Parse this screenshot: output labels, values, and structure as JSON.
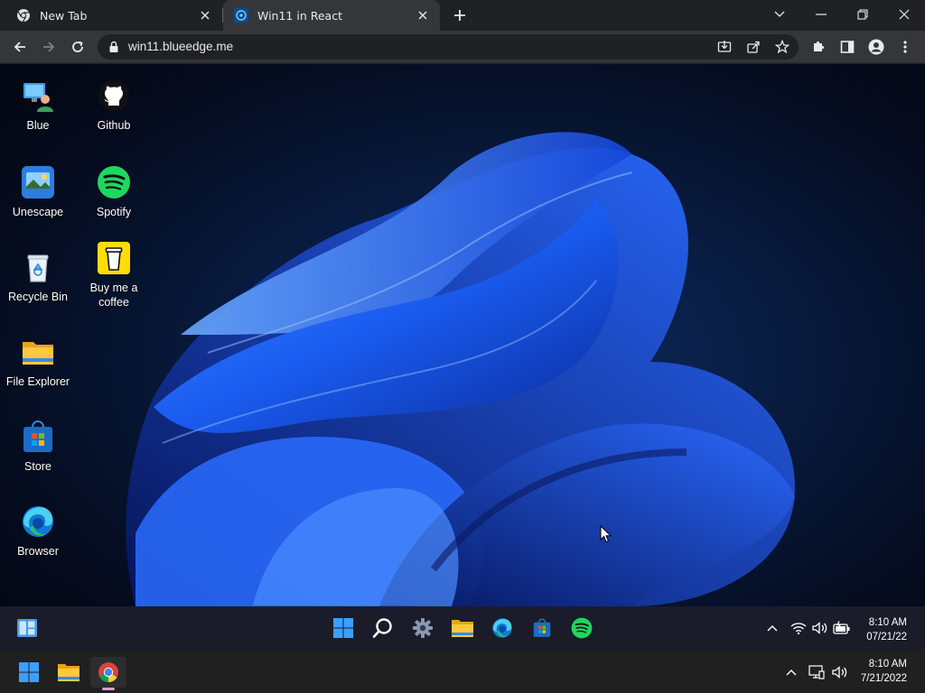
{
  "browser": {
    "tabs": [
      {
        "title": "New Tab"
      },
      {
        "title": "Win11 in React"
      }
    ],
    "url": "win11.blueedge.me"
  },
  "desktop": {
    "icons": [
      {
        "label": "Blue",
        "icon": "user-pc-icon"
      },
      {
        "label": "Github",
        "icon": "github-icon"
      },
      {
        "label": "Unescape",
        "icon": "unescape-icon"
      },
      {
        "label": "Spotify",
        "icon": "spotify-icon"
      },
      {
        "label": "Recycle Bin",
        "icon": "recycle-bin-icon"
      },
      {
        "label": "Buy me a coffee",
        "icon": "coffee-icon"
      },
      {
        "label": "File Explorer",
        "icon": "folder-icon"
      },
      {
        "label": "Store",
        "icon": "store-icon"
      },
      {
        "label": "Browser",
        "icon": "edge-icon"
      }
    ]
  },
  "inner_taskbar": {
    "time": "8:10 AM",
    "date": "07/21/22"
  },
  "host_taskbar": {
    "time": "8:10 AM",
    "date": "7/21/2022"
  },
  "colors": {
    "accent_blue": "#1a6cf0",
    "spotify_green": "#1ed760",
    "chrome_bg": "#202124"
  }
}
